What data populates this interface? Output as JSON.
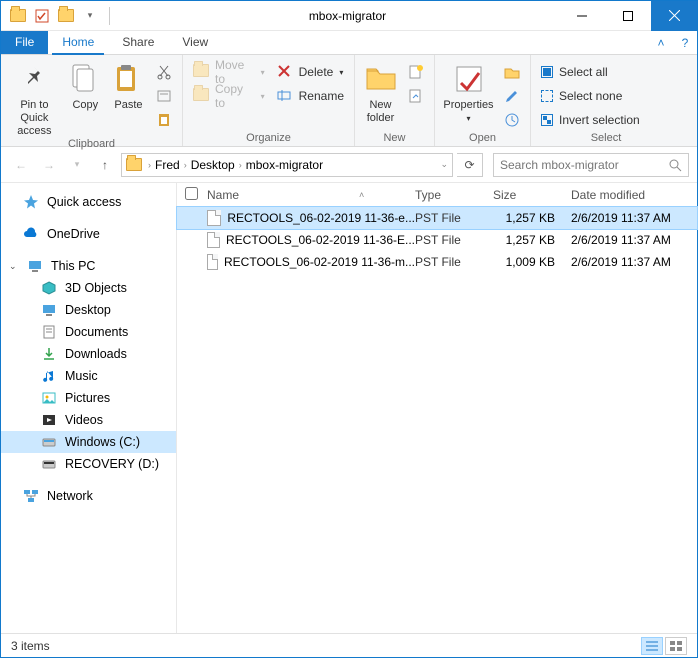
{
  "window": {
    "title": "mbox-migrator"
  },
  "tabs": {
    "file": "File",
    "home": "Home",
    "share": "Share",
    "view": "View"
  },
  "ribbon": {
    "clipboard": {
      "label": "Clipboard",
      "pin": "Pin to Quick\naccess",
      "copy": "Copy",
      "paste": "Paste"
    },
    "organize": {
      "label": "Organize",
      "moveto": "Move to",
      "copyto": "Copy to",
      "delete": "Delete",
      "rename": "Rename"
    },
    "new": {
      "label": "New",
      "newfolder": "New\nfolder"
    },
    "open": {
      "label": "Open",
      "properties": "Properties"
    },
    "select": {
      "label": "Select",
      "all": "Select all",
      "none": "Select none",
      "invert": "Invert selection"
    }
  },
  "address": {
    "crumbs": [
      "Fred",
      "Desktop",
      "mbox-migrator"
    ],
    "search_placeholder": "Search mbox-migrator"
  },
  "nav": {
    "quick": "Quick access",
    "onedrive": "OneDrive",
    "thispc": "This PC",
    "items": [
      "3D Objects",
      "Desktop",
      "Documents",
      "Downloads",
      "Music",
      "Pictures",
      "Videos",
      "Windows (C:)",
      "RECOVERY (D:)"
    ],
    "network": "Network"
  },
  "columns": {
    "name": "Name",
    "type": "Type",
    "size": "Size",
    "date": "Date modified"
  },
  "files": [
    {
      "name": "RECTOOLS_06-02-2019 11-36-e...",
      "type": "PST File",
      "size": "1,257 KB",
      "date": "2/6/2019 11:37 AM",
      "selected": true
    },
    {
      "name": "RECTOOLS_06-02-2019 11-36-E...",
      "type": "PST File",
      "size": "1,257 KB",
      "date": "2/6/2019 11:37 AM",
      "selected": false
    },
    {
      "name": "RECTOOLS_06-02-2019 11-36-m...",
      "type": "PST File",
      "size": "1,009 KB",
      "date": "2/6/2019 11:37 AM",
      "selected": false
    }
  ],
  "status": {
    "count": "3 items"
  }
}
